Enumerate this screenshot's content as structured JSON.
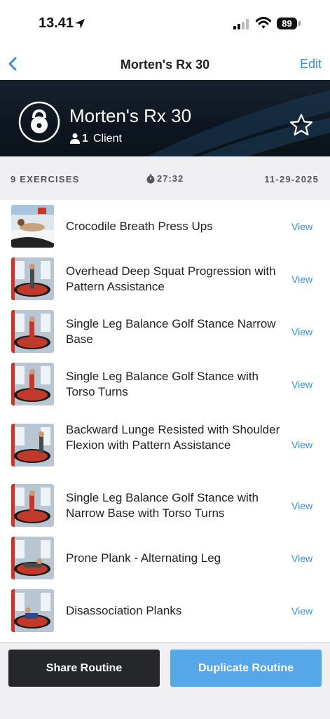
{
  "status_bar": {
    "time": "13.41",
    "battery": "89"
  },
  "nav": {
    "back_icon": "chevron-left-icon",
    "title": "Morten's Rx 30",
    "edit_label": "Edit"
  },
  "header": {
    "title": "Morten's Rx 30",
    "client_count": "1",
    "client_label": "Client",
    "icon": "kettlebell-icon",
    "favorite_icon": "star-outline-icon"
  },
  "summary": {
    "exercise_count": "9 EXERCISES",
    "duration": "27:32",
    "date": "11-29-2025"
  },
  "exercises": [
    {
      "name": "Crocodile Breath Press Ups",
      "action": "View"
    },
    {
      "name": "Overhead Deep Squat Progression with Pattern Assistance",
      "action": "View"
    },
    {
      "name": "Single Leg Balance Golf Stance Narrow Base",
      "action": "View"
    },
    {
      "name": "Single Leg Balance Golf Stance with Torso Turns",
      "action": "View"
    },
    {
      "name": "Backward Lunge Resisted with Shoulder Flexion with Pattern Assistance",
      "action": "View"
    },
    {
      "name": "Single Leg Balance Golf Stance with Narrow Base with Torso Turns",
      "action": "View"
    },
    {
      "name": "Prone Plank - Alternating Leg",
      "action": "View"
    },
    {
      "name": "Disassociation Planks",
      "action": "View"
    }
  ],
  "footer": {
    "share_label": "Share Routine",
    "duplicate_label": "Duplicate Routine"
  },
  "colors": {
    "accent": "#3a8fd9",
    "duplicate_button": "#56a6ea",
    "share_button": "#26272b",
    "header_bg": "#0d1620"
  }
}
